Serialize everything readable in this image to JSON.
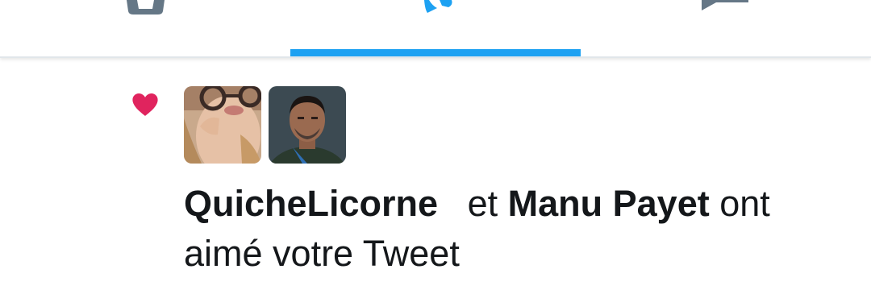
{
  "colors": {
    "accent": "#1da1f2",
    "like": "#e0245e",
    "icon_inactive": "#657786",
    "text": "#14171a"
  },
  "tabs": [
    {
      "icon": "home-icon",
      "active": false
    },
    {
      "icon": "notifications-bell-icon",
      "active": true
    },
    {
      "icon": "messages-icon",
      "active": false
    }
  ],
  "notification": {
    "type_icon": "heart-icon",
    "avatars": [
      {
        "user": "QuicheLicorne"
      },
      {
        "user": "Manu Payet"
      }
    ],
    "user1": "QuicheLicorne",
    "connector": "et",
    "user2": "Manu Payet",
    "text_line1_end": "ont",
    "text_line2": "aimé votre Tweet"
  }
}
